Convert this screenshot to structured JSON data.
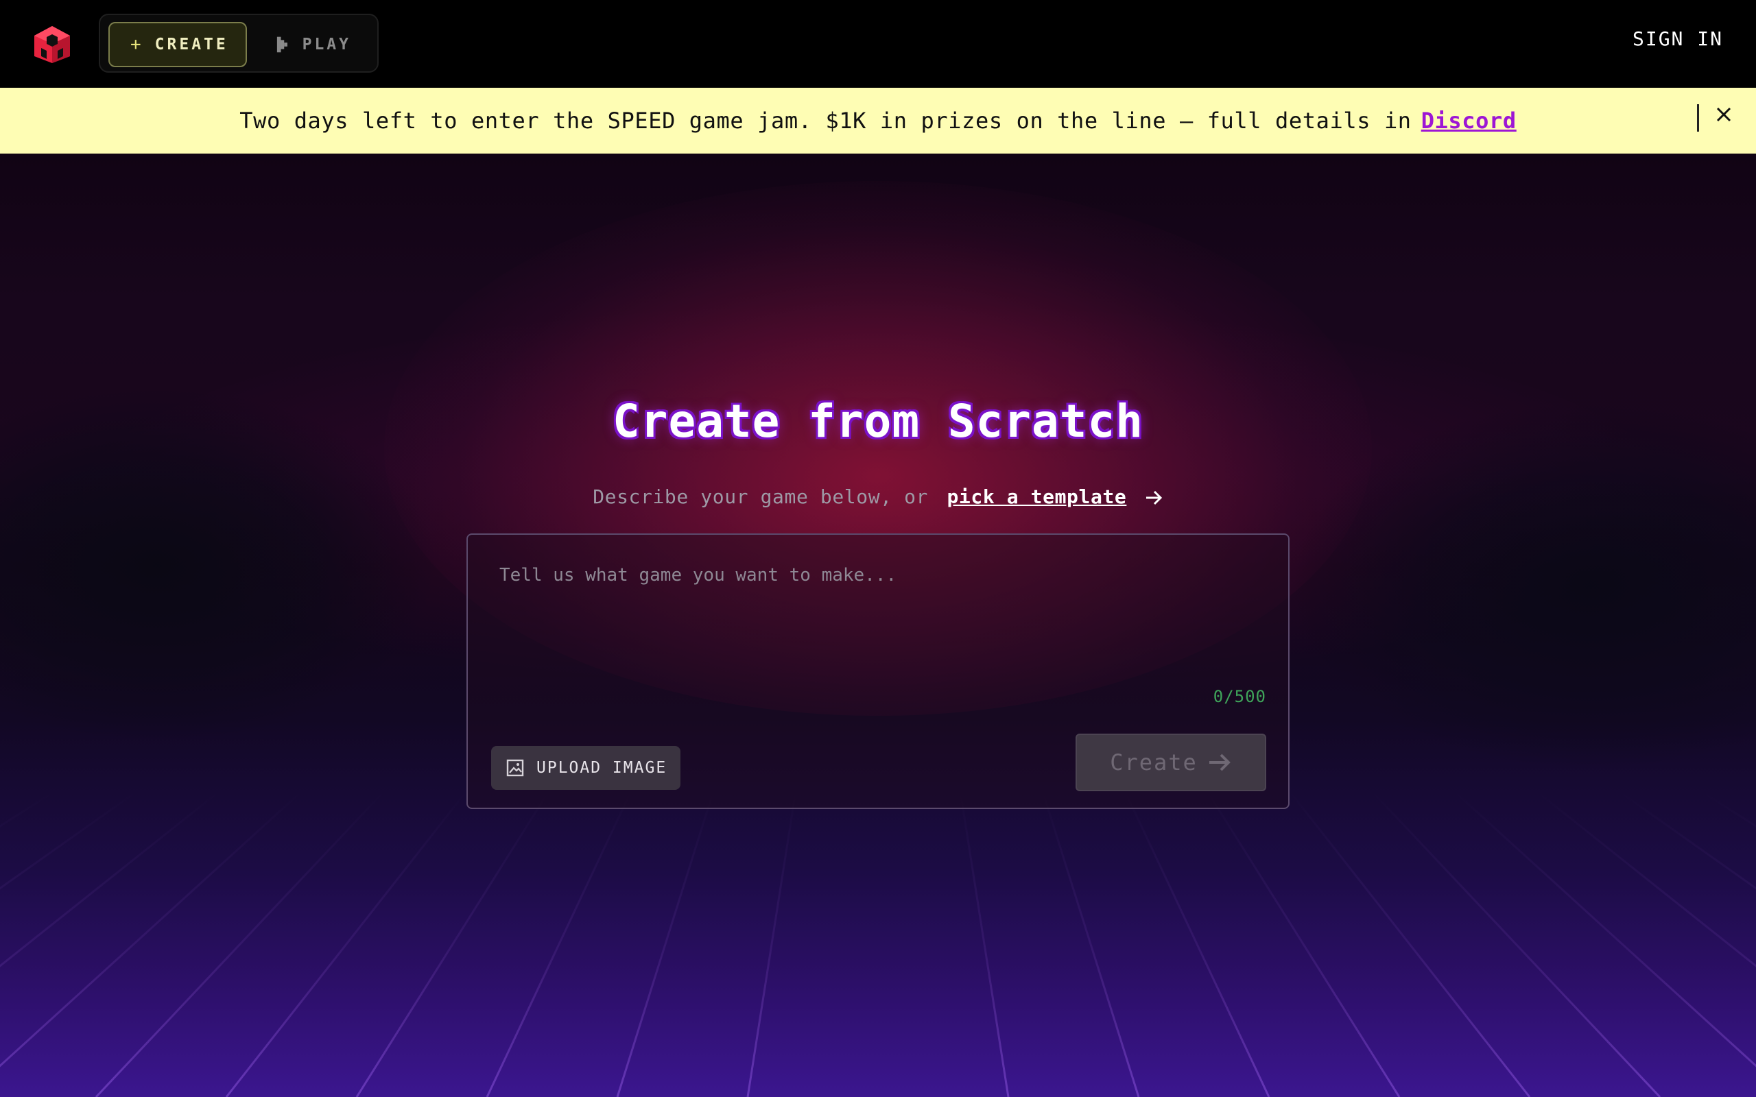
{
  "nav": {
    "create_label": "CREATE",
    "play_label": "PLAY",
    "sign_in_label": "SIGN IN"
  },
  "banner": {
    "text": "Two days left to enter the SPEED game jam. $1K in prizes on the line — full details in",
    "link_label": "Discord"
  },
  "hero": {
    "title": "Create from Scratch",
    "subtitle_prefix": "Describe your game below, or",
    "template_link_label": "pick a template"
  },
  "prompt": {
    "placeholder": "Tell us what game you want to make...",
    "value": "",
    "counter": "0/500",
    "upload_label": "UPLOAD IMAGE",
    "create_label": "Create"
  },
  "icons": {
    "logo": "cube-logo-icon",
    "create": "plus-crosshair-icon",
    "play": "play-icon",
    "close": "close-icon",
    "arrow": "arrow-right-icon",
    "image": "image-icon"
  },
  "colors": {
    "banner_bg": "#fefdb4",
    "banner_link": "#9d16d4",
    "title_outline": "#7a12c8",
    "counter": "#3fa45a",
    "logo": "#e8233f"
  }
}
